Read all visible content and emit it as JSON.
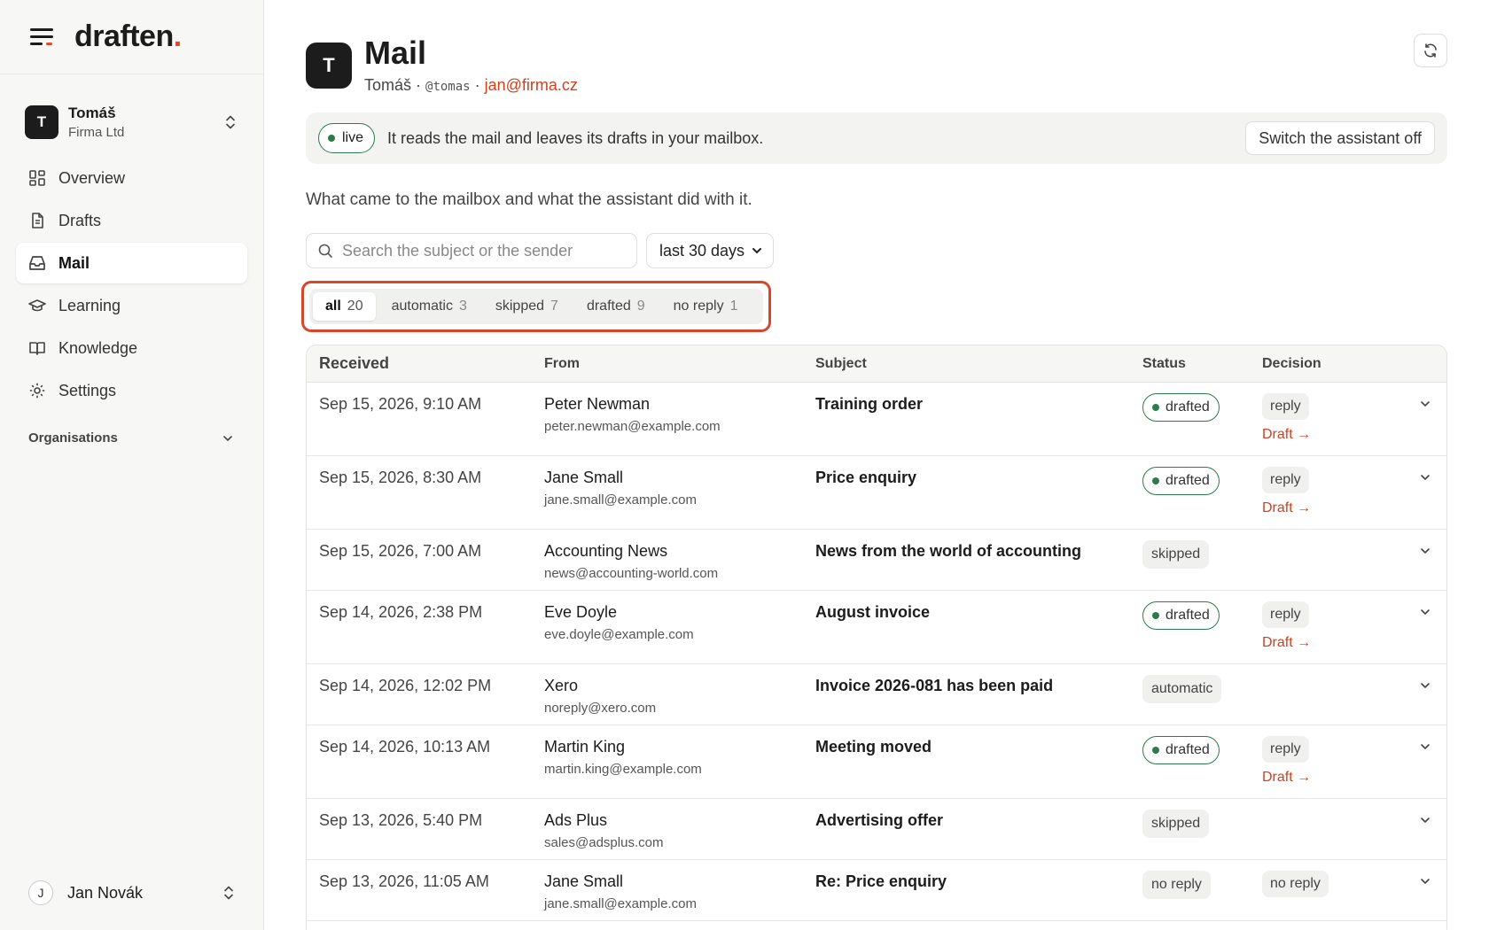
{
  "brand": {
    "name": "draften",
    "dot": ".",
    "accent": "#e0492a"
  },
  "account": {
    "initial": "T",
    "name": "Tomáš",
    "org": "Firma Ltd"
  },
  "nav": {
    "items": [
      {
        "label": "Overview",
        "icon": "grid-icon"
      },
      {
        "label": "Drafts",
        "icon": "document-icon"
      },
      {
        "label": "Mail",
        "icon": "inbox-icon",
        "active": true
      },
      {
        "label": "Learning",
        "icon": "graduation-cap-icon"
      },
      {
        "label": "Knowledge",
        "icon": "book-icon"
      },
      {
        "label": "Settings",
        "icon": "gear-icon"
      }
    ],
    "organisations_label": "Organisations"
  },
  "user": {
    "initial": "J",
    "name": "Jan Novák"
  },
  "header": {
    "initial": "T",
    "title": "Mail",
    "name": "Tomáš",
    "sep1": " · ",
    "handle": "@tomas",
    "sep2": " · ",
    "email": "jan@firma.cz"
  },
  "banner": {
    "badge": "live",
    "text": "It reads the mail and leaves its drafts in your mailbox.",
    "button": "Switch the assistant off"
  },
  "description": "What came to the mailbox and what the assistant did with it.",
  "filters": {
    "search_placeholder": "Search the subject or the sender",
    "period": "last 30 days"
  },
  "tabs": [
    {
      "label": "all",
      "count": "20",
      "active": true
    },
    {
      "label": "automatic",
      "count": "3"
    },
    {
      "label": "skipped",
      "count": "7"
    },
    {
      "label": "drafted",
      "count": "9"
    },
    {
      "label": "no reply",
      "count": "1"
    }
  ],
  "table": {
    "headers": {
      "received": "Received",
      "from": "From",
      "subject": "Subject",
      "status": "Status",
      "decision": "Decision"
    },
    "rows": [
      {
        "received": "Sep 15, 2026, 9:10 AM",
        "from_name": "Peter Newman",
        "from_email": "peter.newman@example.com",
        "subject": "Training order",
        "status": "drafted",
        "decision": "reply",
        "link": "Draft →"
      },
      {
        "received": "Sep 15, 2026, 8:30 AM",
        "from_name": "Jane Small",
        "from_email": "jane.small@example.com",
        "subject": "Price enquiry",
        "status": "drafted",
        "decision": "reply",
        "link": "Draft →"
      },
      {
        "received": "Sep 15, 2026, 7:00 AM",
        "from_name": "Accounting News",
        "from_email": "news@accounting-world.com",
        "subject": "News from the world of accounting",
        "status": "skipped"
      },
      {
        "received": "Sep 14, 2026, 2:38 PM",
        "from_name": "Eve Doyle",
        "from_email": "eve.doyle@example.com",
        "subject": "August invoice",
        "status": "drafted",
        "decision": "reply",
        "link": "Draft →"
      },
      {
        "received": "Sep 14, 2026, 12:02 PM",
        "from_name": "Xero",
        "from_email": "noreply@xero.com",
        "subject": "Invoice 2026-081 has been paid",
        "status": "automatic"
      },
      {
        "received": "Sep 14, 2026, 10:13 AM",
        "from_name": "Martin King",
        "from_email": "martin.king@example.com",
        "subject": "Meeting moved",
        "status": "drafted",
        "decision": "reply",
        "link": "Draft →"
      },
      {
        "received": "Sep 13, 2026, 5:40 PM",
        "from_name": "Ads Plus",
        "from_email": "sales@adsplus.com",
        "subject": "Advertising offer",
        "status": "skipped"
      },
      {
        "received": "Sep 13, 2026, 11:05 AM",
        "from_name": "Jane Small",
        "from_email": "jane.small@example.com",
        "subject": "Re: Price enquiry",
        "status": "no reply",
        "decision": "no reply"
      }
    ]
  }
}
